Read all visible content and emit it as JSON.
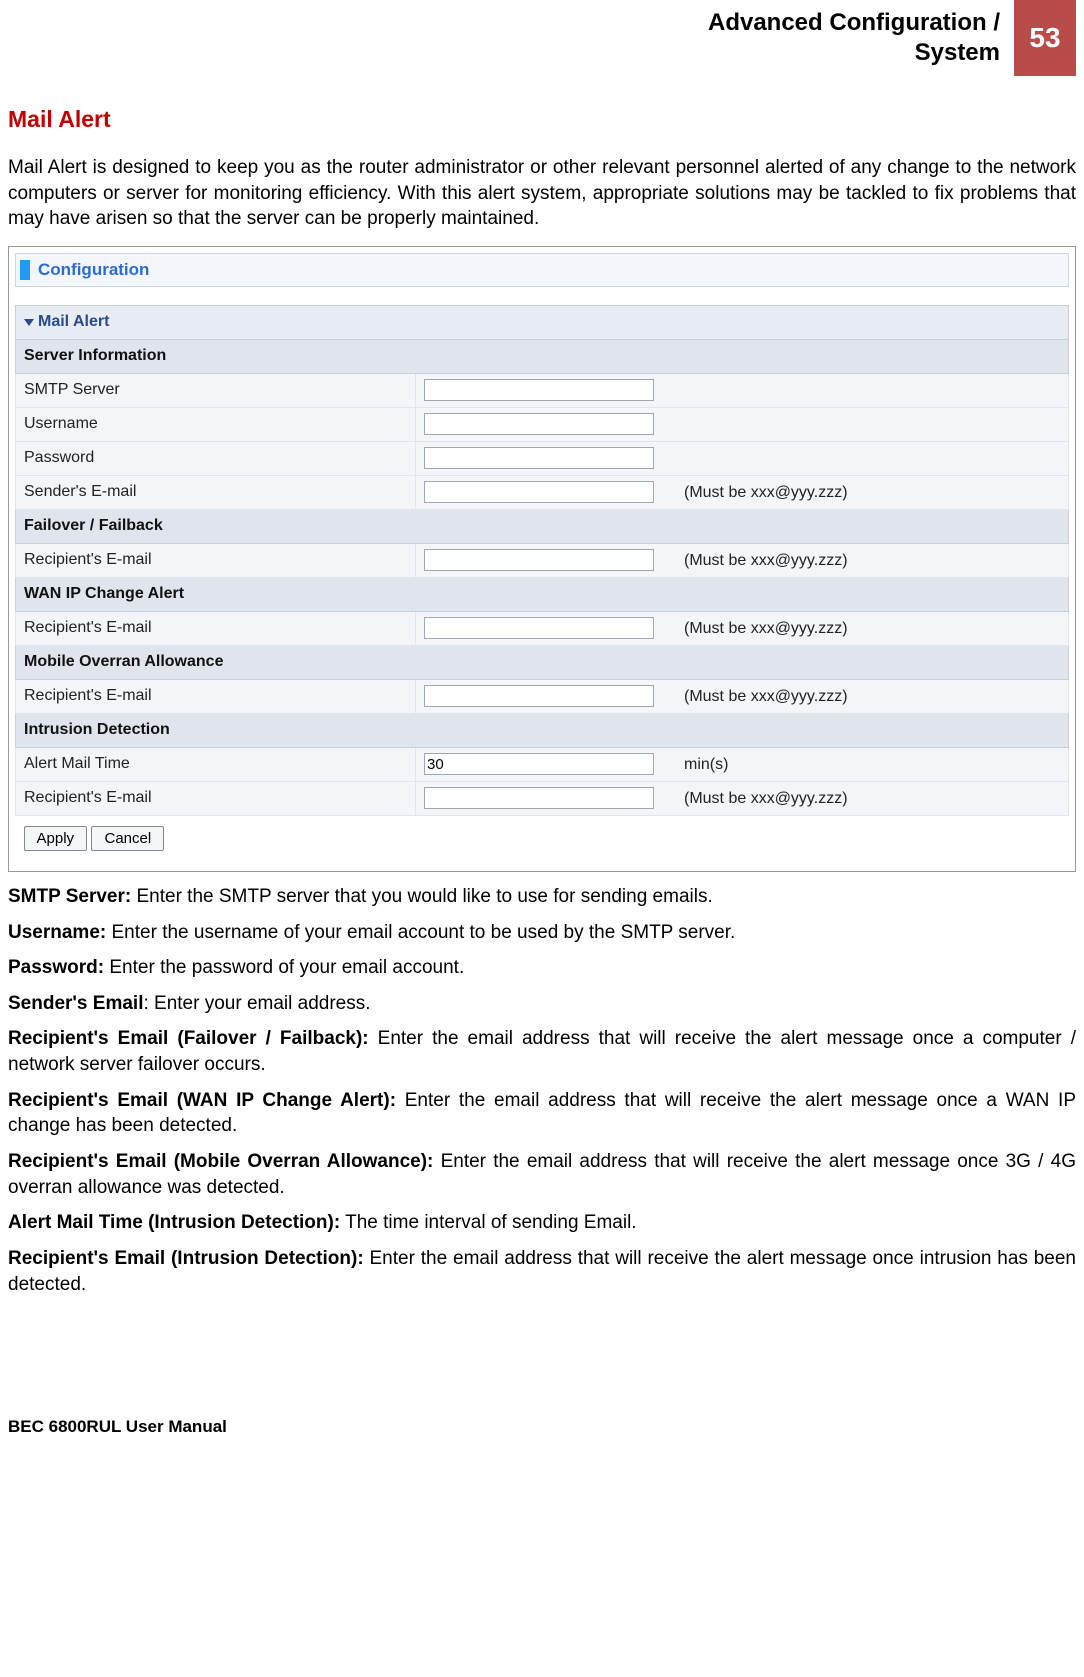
{
  "header": {
    "title_line1": "Advanced Configuration /",
    "title_line2": "System",
    "page_number": "53"
  },
  "section_title": "Mail Alert",
  "intro": "Mail Alert is designed to keep you as the router administrator or other relevant personnel alerted of any change to the network computers or server for monitoring efficiency. With this alert system, appropriate solutions may be tackled to fix problems that may have arisen so that the server can be properly maintained.",
  "config_panel": {
    "header": "Configuration",
    "panel_title": "Mail Alert",
    "sections": {
      "server_info": "Server Information",
      "failover": "Failover / Failback",
      "wan_ip": "WAN IP Change Alert",
      "mobile_overran": "Mobile Overran Allowance",
      "intrusion": "Intrusion Detection"
    },
    "fields": {
      "smtp_server": "SMTP Server",
      "username": "Username",
      "password": "Password",
      "sender_email": "Sender's E-mail",
      "recipient_email": "Recipient's E-mail",
      "alert_mail_time": "Alert Mail Time",
      "alert_mail_time_value": "30",
      "alert_mail_time_unit": "min(s)",
      "email_hint": "(Must be xxx@yyy.zzz)"
    },
    "buttons": {
      "apply": "Apply",
      "cancel": "Cancel"
    }
  },
  "descriptions": [
    {
      "term": "SMTP Server:",
      "text": " Enter the SMTP server that you would like to use for sending emails."
    },
    {
      "term": "Username:",
      "text": " Enter the username of your email account to be used by the SMTP server."
    },
    {
      "term": "Password:",
      "text": " Enter the password of your email account."
    },
    {
      "term": "Sender's Email",
      "text": ": Enter your email address."
    },
    {
      "term": "Recipient's Email (Failover / Failback):",
      "text": " Enter the email address that will receive the alert message once a computer / network server failover occurs."
    },
    {
      "term": "Recipient's Email (WAN IP Change Alert):",
      "text": " Enter the email address that will receive the alert message once a WAN IP change has been detected."
    },
    {
      "term": "Recipient's Email (Mobile Overran Allowance):",
      "text": " Enter the email address that will receive the alert message once 3G / 4G overran allowance was detected."
    },
    {
      "term": "Alert Mail Time (Intrusion Detection):",
      "text": " The time interval of sending Email."
    },
    {
      "term": "Recipient's Email (Intrusion Detection):",
      "text": " Enter the email address that will receive the alert message once intrusion has been detected."
    }
  ],
  "footer": "BEC 6800RUL User Manual"
}
